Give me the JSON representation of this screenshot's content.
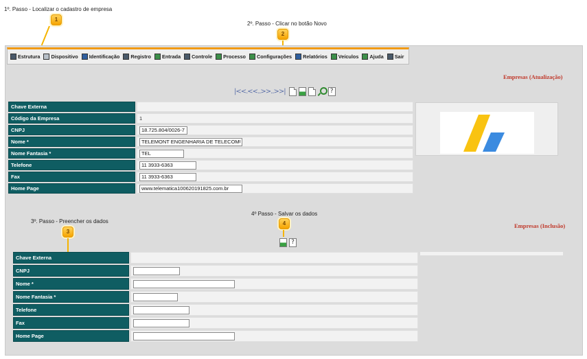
{
  "steps": {
    "step1_text": "1º. Passo - Localizar o cadastro de empresa",
    "step2_text": "2º. Passo - Clicar no botão Novo",
    "step3_text": "3º. Passo - Preencher os dados",
    "step4_text": "4º Passo - Salvar os dados",
    "badges": [
      "1",
      "2",
      "3",
      "4"
    ]
  },
  "menu": {
    "items": [
      {
        "label": "Estrutura",
        "icon": "structure-icon"
      },
      {
        "label": "Dispositivo",
        "icon": "device-icon"
      },
      {
        "label": "Identificação",
        "icon": "identification-icon"
      },
      {
        "label": "Registro",
        "icon": "register-icon"
      },
      {
        "label": "Entrada",
        "icon": "entry-icon"
      },
      {
        "label": "Controle",
        "icon": "control-icon"
      },
      {
        "label": "Processo",
        "icon": "process-icon"
      },
      {
        "label": "Configurações",
        "icon": "settings-icon"
      },
      {
        "label": "Relatórios",
        "icon": "reports-icon"
      },
      {
        "label": "Veículos",
        "icon": "vehicles-icon"
      },
      {
        "label": "Ajuda",
        "icon": "help-icon"
      },
      {
        "label": "Sair",
        "icon": "exit-icon"
      }
    ]
  },
  "update_section": {
    "title": "Empresas (Atualização)",
    "nav_text": "|<<.<<..>>..>>|",
    "toolbar_help": "?",
    "fields": [
      {
        "label": "Chave Externa",
        "value": "",
        "type": "plain"
      },
      {
        "label": "Código da Empresa",
        "value": "1",
        "type": "plain"
      },
      {
        "label": "CNPJ",
        "value": "18.725.804/0026-7",
        "type": "input"
      },
      {
        "label": "Nome *",
        "value": "TELEMONT ENGENHARIA DE TELECOMU",
        "type": "input"
      },
      {
        "label": "Nome Fantasia *",
        "value": "TEL",
        "type": "input"
      },
      {
        "label": "Telefone",
        "value": "11 3933-6363",
        "type": "input"
      },
      {
        "label": "Fax",
        "value": "11 3933-6363",
        "type": "input"
      },
      {
        "label": "Home Page",
        "value": "www.telematica100620191825.com.br",
        "type": "input"
      }
    ]
  },
  "insert_section": {
    "title": "Empresas (Inclusão)",
    "toolbar_help": "?",
    "fields": [
      {
        "label": "Chave Externa",
        "value": "",
        "type": "plain"
      },
      {
        "label": "CNPJ",
        "value": "",
        "type": "input"
      },
      {
        "label": "Nome *",
        "value": "",
        "type": "input"
      },
      {
        "label": "Nome Fantasia *",
        "value": "",
        "type": "input"
      },
      {
        "label": "Telefone",
        "value": "",
        "type": "input"
      },
      {
        "label": "Fax",
        "value": "",
        "type": "input"
      },
      {
        "label": "Home Page",
        "value": "",
        "type": "input"
      }
    ]
  },
  "colors": {
    "label_bg": "#0f5d62",
    "accent": "#f29a13",
    "title_red": "#c0392b",
    "logo_yellow": "#f9c311",
    "logo_blue": "#3b8be0"
  }
}
